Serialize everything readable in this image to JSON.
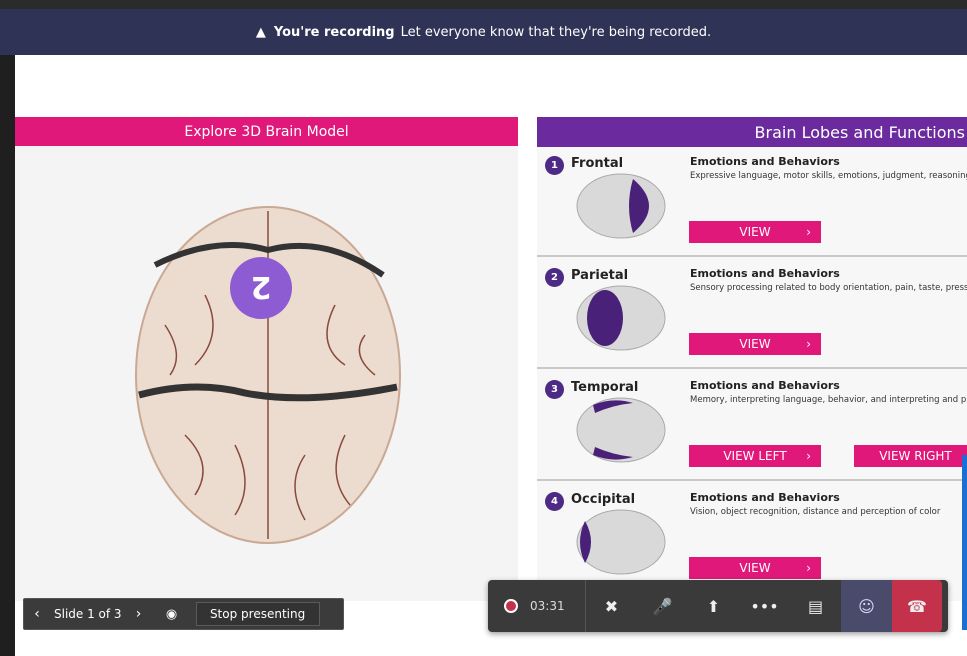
{
  "banner": {
    "warning_icon": "warning-triangle-icon",
    "title": "You're recording",
    "message": "Let everyone know that they're being recorded."
  },
  "left_panel": {
    "header": "Explore 3D Brain Model",
    "marker_label": "2"
  },
  "presenter_bar": {
    "prev_icon": "chevron-left-icon",
    "slide_text": "Slide 1 of 3",
    "next_icon": "chevron-right-icon",
    "eye_icon": "eye-icon",
    "stop_label": "Stop presenting"
  },
  "right_panel": {
    "header": "Brain Lobes and Functions",
    "lobes": [
      {
        "number": "1",
        "name": "Frontal",
        "title": "Emotions and Behaviors",
        "desc": "Expressive language, motor skills, emotions, judgment, reasoning, a",
        "buttons": [
          "VIEW"
        ]
      },
      {
        "number": "2",
        "name": "Parietal",
        "title": "Emotions and Behaviors",
        "desc": "Sensory processing related to body orientation, pain, taste, pressure",
        "buttons": [
          "VIEW"
        ]
      },
      {
        "number": "3",
        "name": "Temporal",
        "title": "Emotions and Behaviors",
        "desc": "Memory, interpreting language, behavior, and interpreting and proc",
        "buttons": [
          "VIEW LEFT",
          "VIEW RIGHT"
        ]
      },
      {
        "number": "4",
        "name": "Occipital",
        "title": "Emotions and Behaviors",
        "desc": "Vision, object recognition, distance and perception of color",
        "buttons": [
          "VIEW"
        ]
      }
    ]
  },
  "call_bar": {
    "timer": "03:31",
    "icons": [
      "record-icon",
      "camera-off-icon",
      "microphone-icon",
      "share-screen-icon",
      "more-icon",
      "chat-icon",
      "people-icon",
      "hang-up-icon"
    ]
  },
  "colors": {
    "accent_pink": "#e0187a",
    "accent_purple": "#6b2b9e",
    "banner_bg": "#2f3456",
    "hangup_red": "#c4314b"
  }
}
